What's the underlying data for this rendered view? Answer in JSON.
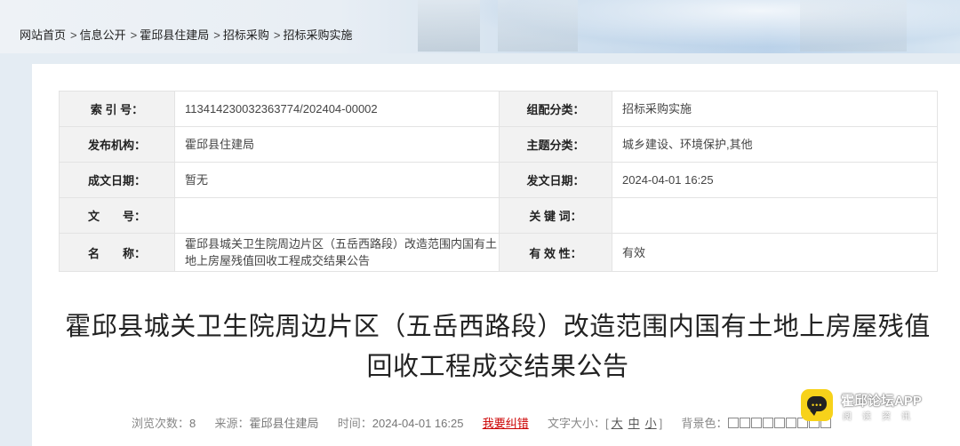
{
  "breadcrumb": {
    "items": [
      "网站首页",
      "信息公开",
      "霍邱县住建局",
      "招标采购",
      "招标采购实施"
    ],
    "separator": ">"
  },
  "meta": {
    "rows": [
      {
        "label1": "索 引 号：",
        "value1": "113414230032363774/202404-00002",
        "label2": "组配分类：",
        "value2": "招标采购实施"
      },
      {
        "label1": "发布机构：",
        "value1": "霍邱县住建局",
        "label2": "主题分类：",
        "value2": "城乡建设、环境保护,其他"
      },
      {
        "label1": "成文日期：",
        "value1": "暂无",
        "label2": "发文日期：",
        "value2": "2024-04-01 16:25"
      },
      {
        "label1": "文　　号：",
        "value1": "",
        "label2": "关 键 词：",
        "value2": ""
      },
      {
        "label1": "名　　称：",
        "value1": "霍邱县城关卫生院周边片区（五岳西路段）改造范围内国有土地上房屋残值回收工程成交结果公告",
        "label2": "有 效 性：",
        "value2": "有效"
      }
    ]
  },
  "article": {
    "title_line1": "霍邱县城关卫生院周边片区（五岳西路段）改造范围内国有土地上房屋残值",
    "title_line2": "回收工程成交结果公告"
  },
  "info": {
    "views_label": "浏览次数：",
    "views": "8",
    "source_label": "来源：",
    "source": "霍邱县住建局",
    "time_label": "时间：",
    "time": "2024-04-01 16:25",
    "report_error": "我要纠错",
    "font_size_label": "文字大小：[",
    "size_large": "大",
    "size_medium": "中",
    "size_small": "小",
    "font_size_close": "]",
    "bg_label": "背景色：",
    "swatches": [
      "#ffffff",
      "#ffffff",
      "#ffffff",
      "#ffffff",
      "#ffffff",
      "#ffffff",
      "#ffffff",
      "#ffffff",
      "#ffffff"
    ]
  },
  "watermark": {
    "app_name": "霍邱论坛APP",
    "sub": "阅读资讯"
  },
  "colors": {
    "accent_error": "#cc0000",
    "label_bg": "#f2f2f2",
    "badge_yellow": "#f7d21a"
  }
}
